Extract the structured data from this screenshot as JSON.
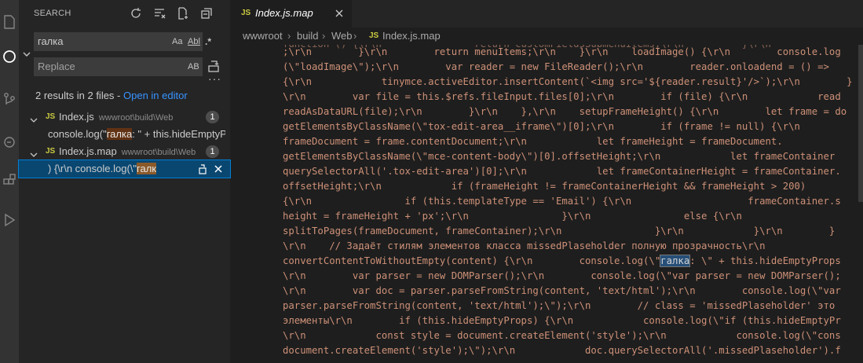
{
  "sidebar": {
    "title": "SEARCH",
    "search": {
      "value": "галка",
      "opt_case": "Aa",
      "opt_word": "Abl",
      "opt_regex": ".*"
    },
    "replace": {
      "placeholder": "Replace",
      "opt_preserve": "AB"
    },
    "summary": {
      "text": "2 results in 2 files - ",
      "link": "Open in editor"
    },
    "files": [
      {
        "type": "JS",
        "name": "Index.js",
        "path": "wwwroot\\build\\Web",
        "count": "1",
        "match": {
          "before": "console.log(\"",
          "hit": "галка",
          "after": ": \" + this.hideEmptyProps"
        }
      },
      {
        "type": "JS",
        "name": "Index.js.map",
        "path": "wwwroot\\build\\Web",
        "count": "1",
        "match": {
          "before": ") {\\r\\n        console.log(\\\"",
          "hit": "галк",
          "after": ""
        }
      }
    ]
  },
  "tab": {
    "type": "JS",
    "label": "Index.js.map"
  },
  "breadcrumb": [
    "wwwroot",
    "build",
    "Web",
    "JS",
    "Index.js.map"
  ],
  "editor": {
    "highlight": "галка",
    "lines": [
      "function () {\\r\\n                return customFieldsSubmenuItems;\\r\\n          }\\r\\n",
      ";\\r\\n        }\\r\\n        return menuItems;\\r\\n    }\\r\\n    loadImage() {\\r\\n        console.log",
      "(\\\"loadImage\\\");\\r\\n        var reader = new FileReader();\\r\\n        reader.onloadend = () =>",
      "{\\r\\n            tinymce.activeEditor.insertContent(`<img src='${reader.result}'/>`);\\r\\n        }",
      "\\r\\n        var file = this.$refs.fileInput.files[0];\\r\\n        if (file) {\\r\\n            read",
      "readAsDataURL(file);\\r\\n        }\\r\\n    },\\r\\n    setupFrameHeight() {\\r\\n        let frame = do",
      "getElementsByClassName(\\\"tox-edit-area__iframe\\\")[0];\\r\\n        if (frame != null) {\\r\\n",
      "frameDocument = frame.contentDocument;\\r\\n            let frameHeight = frameDocument.",
      "getElementsByClassName(\\\"mce-content-body\\\")[0].offsetHeight;\\r\\n            let frameContainer",
      "querySelectorAll('.tox-edit-area')[0];\\r\\n            let frameContainerHeight = frameContainer.",
      "offsetHeight;\\r\\n            if (frameHeight != frameContainerHeight && frameHeight > 200)",
      "{\\r\\n                if (this.templateType == 'Email') {\\r\\n                    frameContainer.s",
      "height = frameHeight + 'px';\\r\\n                }\\r\\n                else {\\r\\n",
      "splitToPages(frameDocument, frameContainer);\\r\\n                }\\r\\n            }\\r\\n        }",
      "\\r\\n    // Задаёт стилям элементов класса missedPlaseholder полную прозрачность\\r\\n",
      "convertContentToWithoutEmpty(content) {\\r\\n        console.log(\\\"галка: \\\" + this.hideEmptyProps",
      "\\r\\n        var parser = new DOMParser();\\r\\n        console.log(\\\"var parser = new DOMParser();",
      "\\r\\n        var doc = parser.parseFromString(content, 'text/html');\\r\\n        console.log(\\\"var",
      "parser.parseFromString(content, 'text/html');\\\");\\r\\n        // class = 'missedPlaseholder' это",
      "элементы\\r\\n        if (this.hideEmptyProps) {\\r\\n            console.log(\\\"if (this.hideEmptyPr",
      "\\r\\n            const style = document.createElement('style');\\r\\n            console.log(\\\"cons",
      "document.createElement('style');\\\");\\r\\n            doc.querySelectorAll('.missedPlaseholder').f"
    ]
  }
}
